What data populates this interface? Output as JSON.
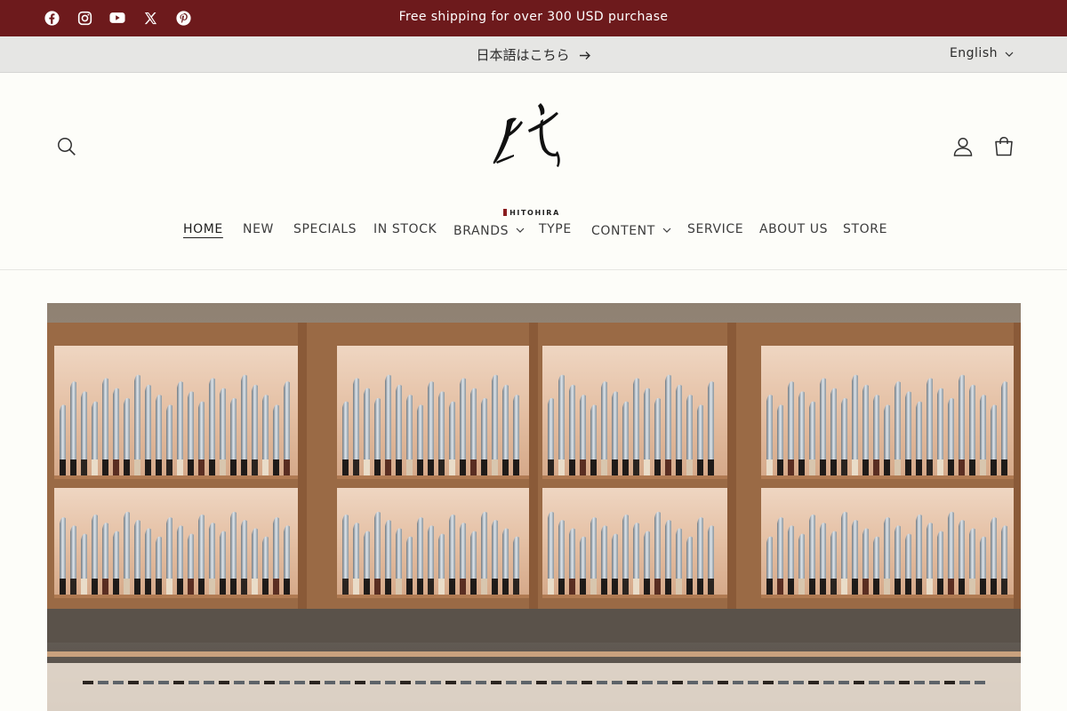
{
  "announcement": {
    "text": "Free shipping for over 300 USD purchase",
    "social_icons": [
      "facebook-icon",
      "instagram-icon",
      "youtube-icon",
      "x-icon",
      "pinterest-icon"
    ]
  },
  "language_bar": {
    "japanese_link": "日本語はこちら",
    "selected_language": "English"
  },
  "brand": {
    "wordmark": "HITOHIRA"
  },
  "nav": {
    "items": [
      {
        "label": "HOME",
        "active": true
      },
      {
        "label": "NEW"
      },
      {
        "label": "SPECIALS"
      },
      {
        "label": "IN STOCK"
      },
      {
        "label": "BRANDS",
        "dropdown": true
      },
      {
        "label": "TYPE"
      },
      {
        "label": "CONTENT",
        "dropdown": true
      },
      {
        "label": "SERVICE"
      },
      {
        "label": "ABOUT US"
      },
      {
        "label": "STORE"
      }
    ]
  },
  "hero": {
    "description": "Knife store display wall with shelves of Japanese kitchen knives"
  },
  "colors": {
    "announcement_bg": "#6d1a1c",
    "language_bar_bg": "#e6e6e4",
    "page_bg": "#fdfdf9"
  }
}
